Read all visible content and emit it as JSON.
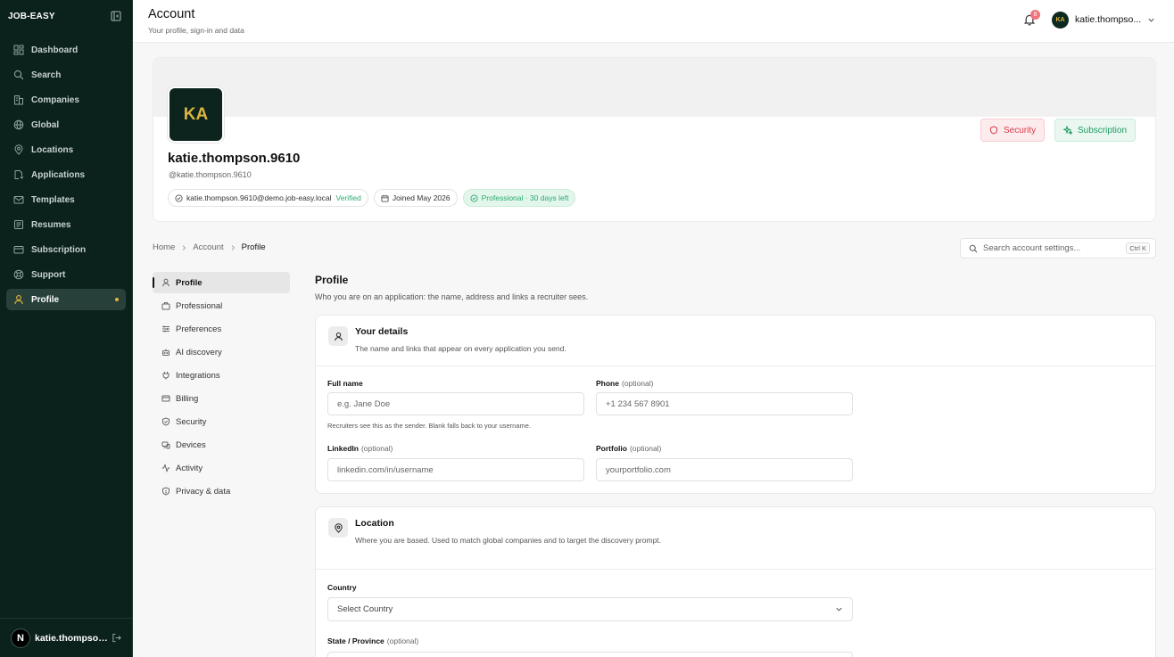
{
  "app": {
    "logo": "JOB-EASY"
  },
  "sidebar": {
    "items": [
      {
        "label": "Dashboard",
        "icon": "dashboard-icon"
      },
      {
        "label": "Search",
        "icon": "search-icon"
      },
      {
        "label": "Companies",
        "icon": "building-icon"
      },
      {
        "label": "Global",
        "icon": "globe-icon"
      },
      {
        "label": "Locations",
        "icon": "map-pin-icon"
      },
      {
        "label": "Applications",
        "icon": "file-send-icon"
      },
      {
        "label": "Templates",
        "icon": "mail-icon"
      },
      {
        "label": "Resumes",
        "icon": "document-icon"
      },
      {
        "label": "Subscription",
        "icon": "wallet-icon"
      },
      {
        "label": "Support",
        "icon": "lifebuoy-icon"
      },
      {
        "label": "Profile",
        "icon": "user-icon",
        "active": true
      }
    ],
    "footer": {
      "avatar": "N",
      "username": "katie.thompson.9610"
    }
  },
  "header": {
    "title": "Account",
    "subtitle": "Your profile, sign-in and data",
    "notifications": "8",
    "avatar": "KA",
    "username": "katie.thompson.9610"
  },
  "profile_card": {
    "avatar": "KA",
    "name": "katie.thompson.9610",
    "handle": "@katie.thompson.9610",
    "email": "katie.thompson.9610@demo.job-easy.local",
    "verified": "Verified",
    "joined": "Joined May 2026",
    "plan": "Professional · 30 days left",
    "security_button": "Security",
    "subscription_button": "Subscription"
  },
  "breadcrumb": {
    "items": [
      "Home",
      "Account",
      "Profile"
    ]
  },
  "settings_search": {
    "placeholder": "Search account settings...",
    "shortcut": "Ctrl K"
  },
  "subnav": {
    "items": [
      {
        "label": "Profile",
        "icon": "user-icon",
        "active": true
      },
      {
        "label": "Professional",
        "icon": "briefcase-icon"
      },
      {
        "label": "Preferences",
        "icon": "sliders-icon"
      },
      {
        "label": "AI discovery",
        "icon": "bot-icon"
      },
      {
        "label": "Integrations",
        "icon": "plug-icon"
      },
      {
        "label": "Billing",
        "icon": "credit-card-icon"
      },
      {
        "label": "Security",
        "icon": "shield-icon"
      },
      {
        "label": "Devices",
        "icon": "devices-icon"
      },
      {
        "label": "Activity",
        "icon": "activity-icon"
      },
      {
        "label": "Privacy & data",
        "icon": "shield-lock-icon"
      }
    ]
  },
  "main": {
    "title": "Profile",
    "subtitle": "Who you are on an application: the name, address and links a recruiter sees.",
    "details": {
      "title": "Your details",
      "description": "The name and links that appear on every application you send.",
      "full_name": {
        "label": "Full name",
        "placeholder": "e.g. Jane Doe",
        "hint": "Recruiters see this as the sender. Blank falls back to your username."
      },
      "phone": {
        "label": "Phone",
        "optional": "(optional)",
        "placeholder": "+1 234 567 8901"
      },
      "linkedin": {
        "label": "LinkedIn",
        "optional": "(optional)",
        "placeholder": "linkedin.com/in/username"
      },
      "portfolio": {
        "label": "Portfolio",
        "optional": "(optional)",
        "placeholder": "yourportfolio.com"
      }
    },
    "location": {
      "title": "Location",
      "description": "Where you are based. Used to match global companies and to target the discovery prompt.",
      "country": {
        "label": "Country",
        "value": "Select Country"
      },
      "state": {
        "label": "State / Province",
        "optional": "(optional)"
      }
    }
  },
  "colors": {
    "sidebar_bg": "#0b211c",
    "accent": "#e3b53a",
    "success": "#2ea971",
    "danger": "#d63b48"
  }
}
